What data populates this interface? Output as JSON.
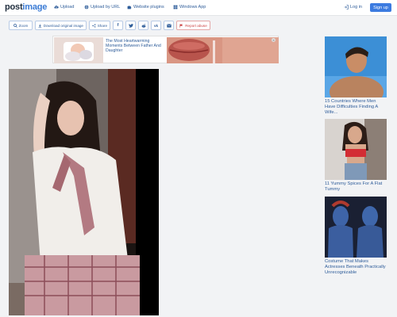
{
  "header": {
    "logo_main": "post",
    "logo_accent": "image",
    "nav": [
      {
        "label": "Upload",
        "icon": "cloud-upload-icon"
      },
      {
        "label": "Upload by URL",
        "icon": "globe-icon"
      },
      {
        "label": "Website plugins",
        "icon": "puzzle-icon"
      },
      {
        "label": "Windows App",
        "icon": "windows-icon"
      }
    ],
    "login": "Log in",
    "signup": "Sign up"
  },
  "toolbar": {
    "zoom": "Zoom",
    "download": "Download original image",
    "share": "Share",
    "social": [
      "f",
      "t",
      "r",
      "vk",
      "mail"
    ],
    "report": "Report abuse"
  },
  "ad": {
    "text": "The Most Heartwarming Moments Between Father And Daughter"
  },
  "sidebar": {
    "items": [
      {
        "caption": "15 Countries Where Men Have Difficulties Finding A Wife..."
      },
      {
        "caption": "11 Yummy Spices For A Flat Tummy"
      },
      {
        "caption": "Costume That Makes Actresses Beneath Practically Unrecognizable"
      }
    ]
  },
  "colors": {
    "accent": "#3c7be0",
    "link": "#2f5d9a",
    "report": "#cc4444"
  }
}
